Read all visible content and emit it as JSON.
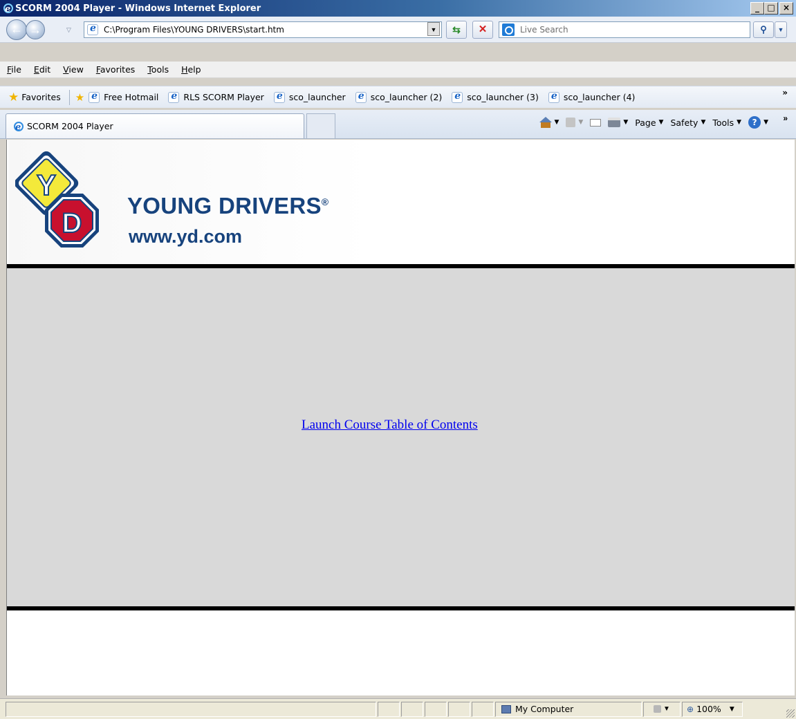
{
  "window": {
    "title": "SCORM 2004 Player - Windows Internet Explorer",
    "buttons": {
      "minimize": "_",
      "maximize": "□",
      "close": "×"
    }
  },
  "address": {
    "url": "C:\\Program Files\\YOUNG DRIVERS\\start.htm",
    "search_placeholder": "Live Search"
  },
  "menu": [
    "File",
    "Edit",
    "View",
    "Favorites",
    "Tools",
    "Help"
  ],
  "favorites": {
    "label": "Favorites",
    "items": [
      "Free Hotmail",
      "RLS SCORM Player",
      "sco_launcher",
      "sco_launcher (2)",
      "sco_launcher (3)",
      "sco_launcher (4)"
    ],
    "more": "»"
  },
  "tab": {
    "title": "SCORM 2004 Player"
  },
  "command_bar": {
    "page": "Page",
    "safety": "Safety",
    "tools": "Tools",
    "more": "»"
  },
  "page": {
    "logo_name": "YOUNG DRIVERS",
    "logo_reg": "®",
    "logo_url": "www.yd.com",
    "logo_letters": {
      "top": "Y",
      "bottom": "D"
    },
    "launch_link": "Launch Course Table of Contents"
  },
  "status": {
    "zone": "My Computer",
    "zoom": "100%"
  },
  "colors": {
    "brand_blue": "#17437d",
    "link": "#0000ee",
    "sign_yellow": "#f4e93a",
    "sign_red": "#c8102e"
  }
}
